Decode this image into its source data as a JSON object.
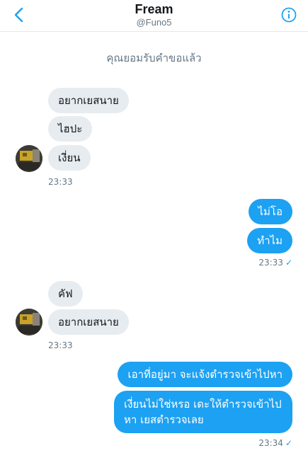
{
  "header": {
    "name": "Fream",
    "handle": "@Funo5"
  },
  "notice": "คุณยอมรับคำขอแล้ว",
  "group1": {
    "messages": [
      "อยากเยสนาย",
      "ไฮปะ",
      "เงี่ยน"
    ],
    "time": "23:33"
  },
  "group2": {
    "messages": [
      "ไม่โอ",
      "ทำไม"
    ],
    "time": "23:33",
    "status": "✓"
  },
  "group3": {
    "messages": [
      "คัฟ",
      "อยากเยสนาย"
    ],
    "time": "23:33"
  },
  "group4": {
    "messages": [
      "เอาที่อยู่มา จะแจ้งตำรวจเข้าไปหา",
      "เงี่ยนไม่ใช่หรอ เดะให้ตำรวจเข้าไปหา เยสตำรวจเลย"
    ],
    "time": "23:34",
    "status": "✓"
  },
  "colors": {
    "accent": "#1da1f2",
    "incoming_bubble": "#e6ecf0",
    "muted_text": "#657786"
  },
  "icons": {
    "back": "chevron-left-icon",
    "info": "info-icon"
  }
}
